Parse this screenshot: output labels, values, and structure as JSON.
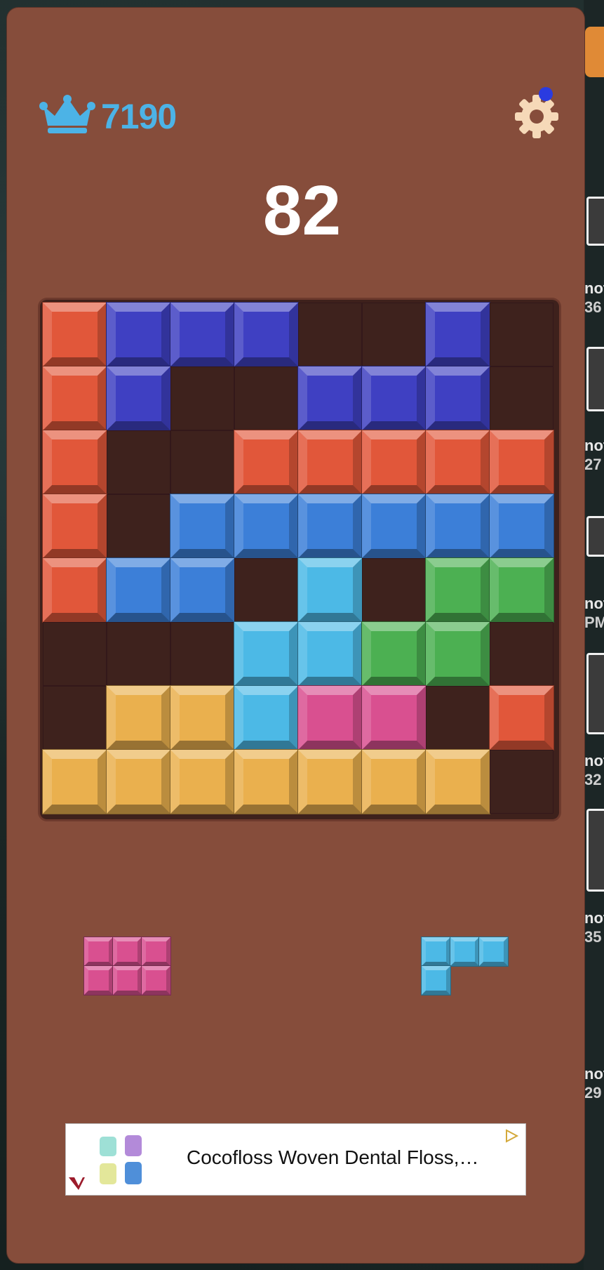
{
  "header": {
    "best_score": "7190",
    "crown_icon": "crown-icon",
    "settings_icon": "gear-icon",
    "notification_color": "#2a3be0"
  },
  "score": "82",
  "colors": {
    "R": "#e1573a",
    "N": "#3f40c2",
    "B": "#3c7fd8",
    "C": "#4cb9e6",
    "G": "#4cb052",
    "Y": "#eab04e",
    "P": "#d95090",
    "empty": "#3e221d",
    "board_bg": "#3e211c",
    "window_bg": "#864d3b"
  },
  "board": [
    [
      "R",
      "N",
      "N",
      "N",
      ".",
      ".",
      "N",
      "."
    ],
    [
      "R",
      "N",
      ".",
      ".",
      "N",
      "N",
      "N",
      "."
    ],
    [
      "R",
      ".",
      ".",
      "R",
      "R",
      "R",
      "R",
      "R"
    ],
    [
      "R",
      ".",
      "B",
      "B",
      "B",
      "B",
      "B",
      "B"
    ],
    [
      "R",
      "B",
      "B",
      ".",
      "C",
      ".",
      "G",
      "G"
    ],
    [
      ".",
      ".",
      ".",
      "C",
      "C",
      "G",
      "G",
      "."
    ],
    [
      ".",
      "Y",
      "Y",
      "C",
      "P",
      "P",
      ".",
      "R"
    ],
    [
      "Y",
      "Y",
      "Y",
      "Y",
      "Y",
      "Y",
      "Y",
      "."
    ]
  ],
  "tray": [
    {
      "name": "pink-3x2-piece",
      "color": "P",
      "cells": [
        [
          0,
          0
        ],
        [
          0,
          1
        ],
        [
          0,
          2
        ],
        [
          1,
          0
        ],
        [
          1,
          1
        ],
        [
          1,
          2
        ]
      ]
    },
    {
      "name": "cyan-l-piece",
      "color": "C",
      "cells": [
        [
          0,
          0
        ],
        [
          0,
          1
        ],
        [
          0,
          2
        ],
        [
          1,
          0
        ]
      ]
    }
  ],
  "ad": {
    "text": "Cocofloss Woven Dental Floss,…",
    "play_icon": "ad-choices-icon"
  },
  "sidebar_fragments": [
    {
      "l1": "not",
      "l2": "36"
    },
    {
      "l1": "not",
      "l2": "27"
    },
    {
      "l1": "not",
      "l2": "PM"
    },
    {
      "l1": "not",
      "l2": "32"
    },
    {
      "l1": "not",
      "l2": "35"
    },
    {
      "l1": "not",
      "l2": "29"
    }
  ]
}
